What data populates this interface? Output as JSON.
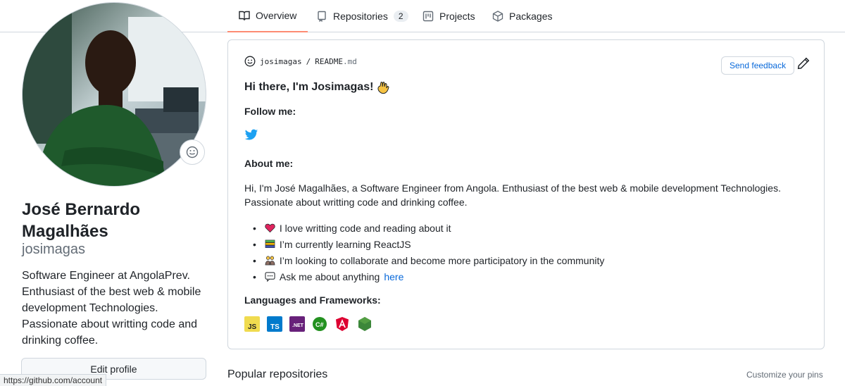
{
  "tabs": [
    {
      "label": "Overview",
      "active": true
    },
    {
      "label": "Repositories",
      "count": "2"
    },
    {
      "label": "Projects"
    },
    {
      "label": "Packages"
    }
  ],
  "profile": {
    "full_name": "José Bernardo Magalhães",
    "username": "josimagas",
    "bio": "Software Engineer at AngolaPrev. Enthusiast of the best web & mobile development Technologies. Passionate about writting code and drinking coffee.",
    "edit_button": "Edit profile"
  },
  "status_url": "https://github.com/account",
  "readme": {
    "breadcrumb_user": "josimagas",
    "breadcrumb_sep": "/",
    "breadcrumb_file": "README",
    "breadcrumb_ext": ".md",
    "feedback_button": "Send feedback",
    "greeting": "Hi there, I'm Josimagas!",
    "follow_heading": "Follow me:",
    "about_heading": "About me:",
    "about_text": "Hi, I'm José Magalhães, a Software Engineer from Angola. Enthusiast of the best web & mobile development Technologies. Passionate about writting code and drinking coffee.",
    "bullets": [
      {
        "text": "I love writting code and reading about it",
        "icon": "heart-icon"
      },
      {
        "text": "I’m currently learning ReactJS",
        "icon": "books-icon"
      },
      {
        "text": "I’m looking to collaborate and become more participatory in the community",
        "icon": "people-icon"
      },
      {
        "text": "Ask me about anything",
        "link": "here",
        "icon": "speech-bubble-icon"
      }
    ],
    "languages_heading": "Languages and Frameworks:",
    "languages": [
      {
        "label": "JS",
        "color": "#f0db4f"
      },
      {
        "label": "TS",
        "color": "#007acc"
      },
      {
        "label": ".NET",
        "color": "#68217a"
      },
      {
        "label": "C#",
        "color": "#239120"
      },
      {
        "label": "Angular",
        "color": "#dd0031"
      },
      {
        "label": "Node.js",
        "color": "#3c873a"
      }
    ]
  },
  "popular_repos_heading": "Popular repositories",
  "customize_pins": "Customize your pins",
  "colors": {
    "accent": "#fd8c73",
    "link": "#0969da",
    "border": "#d0d7de"
  }
}
